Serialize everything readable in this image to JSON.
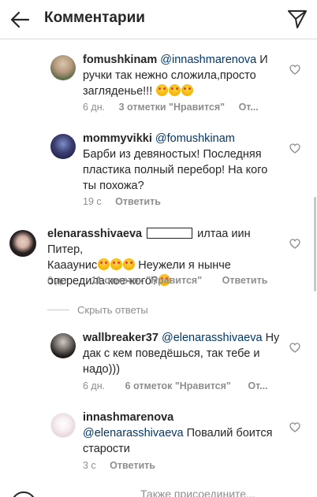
{
  "header": {
    "title": "Комментарии",
    "back_icon": "arrow-left-icon",
    "share_icon": "paper-plane-icon"
  },
  "comments": [
    {
      "username": "fomushkinam",
      "mention": "@innashmarenova",
      "text_1": " И",
      "text_2": "ручки так нежно сложила,просто",
      "text_3": "загляденье!!! ",
      "emoji": [
        "😍",
        "😍",
        "😍"
      ],
      "time": "6 дн.",
      "likes": "3 отметки \"Нравится\"",
      "reply": "От..."
    },
    {
      "username": "mommyvikki",
      "mention": "@fomushkinam",
      "text_1": "Барби из девяностых! Последняя",
      "text_2": "пластика полный перебор! На кого",
      "text_3": "ты похожа?",
      "time": "19 с",
      "reply": "Ответить"
    },
    {
      "username": "elenarasshivaeva",
      "text_1": " илтаа иин Питер,",
      "text_2": "Кааaунис",
      "text_2b": " Неужели я нынче",
      "text_3": "опередила кое-кого?",
      "emoji": [
        "😍",
        "😘",
        "😘",
        "🙄"
      ],
      "time": "6 дн.",
      "likes": "11 отметок \"Нравится\"",
      "reply": "Ответить"
    },
    {
      "username": "wallbreaker37",
      "mention": "@elenarasshivaeva",
      "text_1": " Ну",
      "text_2": "дак с кем поведёшься, так тебе и",
      "text_3": "надо)))",
      "time": "6 дн.",
      "likes": "6 отметок \"Нравится\"",
      "reply": "От..."
    },
    {
      "username": "innashmarenova",
      "mention": "@elenarasshivaeva",
      "text_2": " Повалий боится",
      "text_3": "старости",
      "time": "3 с",
      "reply": "Ответить"
    }
  ],
  "hide_replies": "Скрыть ответы",
  "footer": {
    "text": "Также присоедините..."
  },
  "colors": {
    "mention": "#00376b",
    "meta": "#8e8e8e",
    "text": "#262626"
  }
}
